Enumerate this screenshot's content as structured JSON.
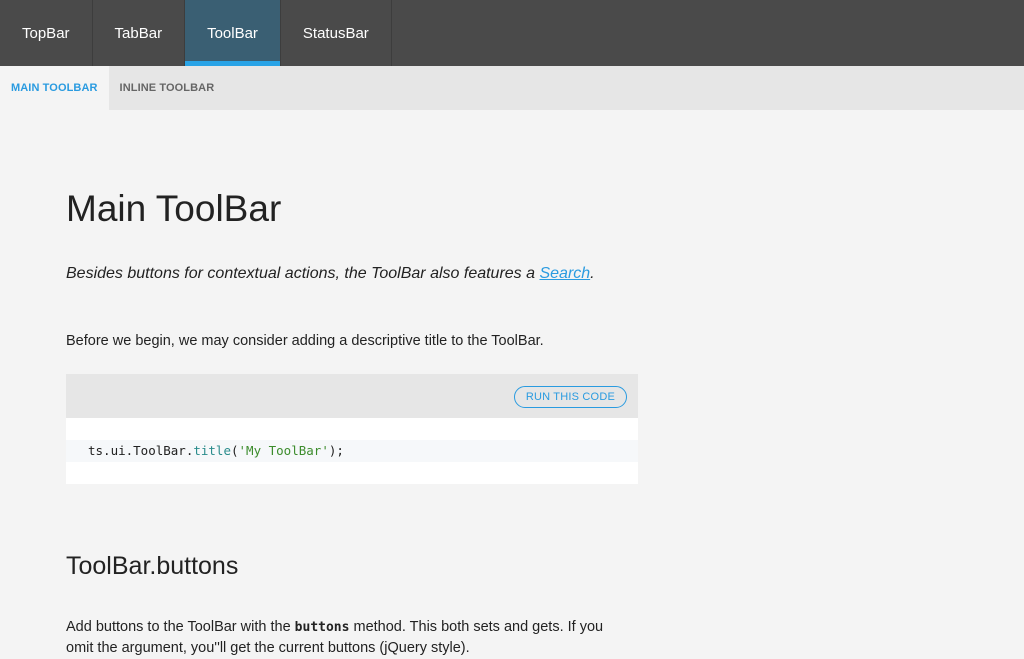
{
  "top_tabs": [
    {
      "label": "TopBar"
    },
    {
      "label": "TabBar"
    },
    {
      "label": "ToolBar"
    },
    {
      "label": "StatusBar"
    }
  ],
  "active_top_tab": "ToolBar",
  "sub_tabs": [
    {
      "label": "MAIN TOOLBAR"
    },
    {
      "label": "INLINE TOOLBAR"
    }
  ],
  "active_sub_tab": "MAIN TOOLBAR",
  "main": {
    "title": "Main ToolBar",
    "lead_before": "Besides buttons for contextual actions, the ToolBar also features a ",
    "lead_link": "Search",
    "lead_after": ".",
    "intro": "Before we begin, we may consider adding a descriptive title to the ToolBar.",
    "code_block": {
      "run_label": "RUN THIS CODE",
      "code_prefix": "ts.ui.ToolBar.",
      "code_method": "title",
      "code_open": "(",
      "code_string": "'My ToolBar'",
      "code_close": ");"
    },
    "section_title": "ToolBar.buttons",
    "section_text_before": "Add buttons to the ToolBar with the ",
    "section_code": "buttons",
    "section_text_after": " method. This both sets and gets. If you omit the argument, you''ll get the current buttons (jQuery style)."
  },
  "colors": {
    "topbar_bg": "#4a4a4a",
    "active_tab_bg": "#3a5f73",
    "accent": "#2a9be0",
    "subbar_bg": "#e6e6e6",
    "page_bg": "#f4f4f4"
  }
}
